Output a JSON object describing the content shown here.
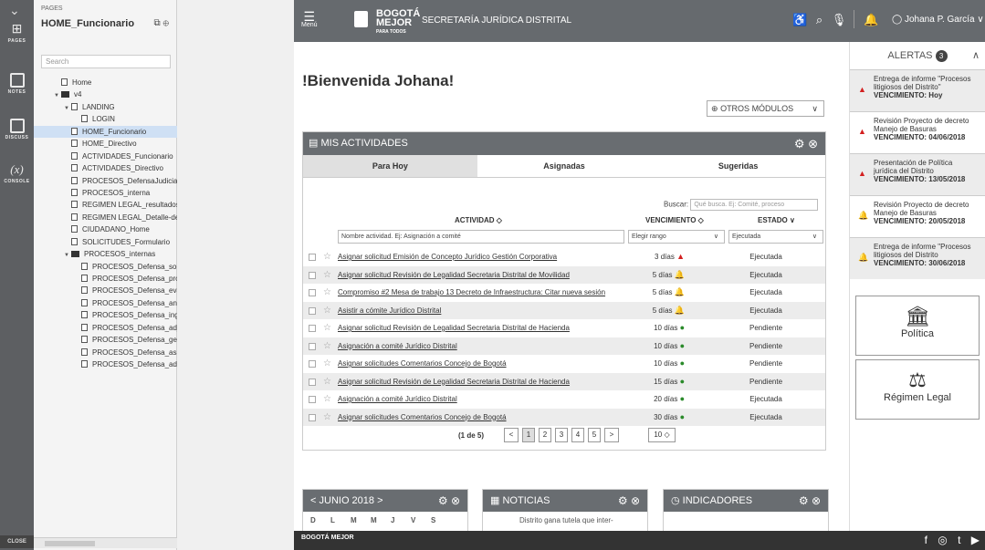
{
  "rail": {
    "items": [
      {
        "label": "PAGES",
        "icon": "sitemap-icon"
      },
      {
        "label": "NOTES",
        "icon": "notes-icon"
      },
      {
        "label": "DISCUSS",
        "icon": "discuss-icon"
      },
      {
        "label": "CONSOLE",
        "icon": "console-icon",
        "glyph": "(x)"
      }
    ],
    "close_label": "CLOSE"
  },
  "pages_panel": {
    "heading": "PAGES",
    "title": "HOME_Funcionario",
    "search_placeholder": "Search",
    "tree": [
      {
        "label": "Home",
        "level": 0,
        "type": "file"
      },
      {
        "label": "v4",
        "level": 0,
        "type": "folder",
        "open": true
      },
      {
        "label": "LANDING",
        "level": 1,
        "type": "file",
        "open": true
      },
      {
        "label": "LOGIN",
        "level": 2,
        "type": "file"
      },
      {
        "label": "HOME_Funcionario",
        "level": 1,
        "type": "file",
        "selected": true
      },
      {
        "label": "HOME_Directivo",
        "level": 1,
        "type": "file"
      },
      {
        "label": "ACTIVIDADES_Funcionario",
        "level": 1,
        "type": "file"
      },
      {
        "label": "ACTIVIDADES_Directivo",
        "level": 1,
        "type": "file"
      },
      {
        "label": "PROCESOS_DefensaJudicial",
        "level": 1,
        "type": "file"
      },
      {
        "label": "PROCESOS_interna",
        "level": 1,
        "type": "file"
      },
      {
        "label": "REGIMEN LEGAL_resultados",
        "level": 1,
        "type": "file"
      },
      {
        "label": "REGIMEN LEGAL_Detalle-decre",
        "level": 1,
        "type": "file"
      },
      {
        "label": "CIUDADANO_Home",
        "level": 1,
        "type": "file"
      },
      {
        "label": "SOLICITUDES_Formulario",
        "level": 1,
        "type": "file"
      },
      {
        "label": "PROCESOS_internas",
        "level": 1,
        "type": "folder",
        "open": true
      },
      {
        "label": "PROCESOS_Defensa_solicit",
        "level": 2,
        "type": "file"
      },
      {
        "label": "PROCESOS_Defensa_proce",
        "level": 2,
        "type": "file"
      },
      {
        "label": "PROCESOS_Defensa_evalu",
        "level": 2,
        "type": "file"
      },
      {
        "label": "PROCESOS_Defensa_anticip",
        "level": 2,
        "type": "file"
      },
      {
        "label": "PROCESOS_Defensa_ingres",
        "level": 2,
        "type": "file"
      },
      {
        "label": "PROCESOS_Defensa_adjunt",
        "level": 2,
        "type": "file"
      },
      {
        "label": "PROCESOS_Defensa_gestio",
        "level": 2,
        "type": "file"
      },
      {
        "label": "PROCESOS_Defensa_asigna",
        "level": 2,
        "type": "file"
      },
      {
        "label": "PROCESOS_Defensa_admin",
        "level": 2,
        "type": "file"
      }
    ]
  },
  "topbar": {
    "menu_label": "Menú",
    "logo_line1": "BOGOTÁ",
    "logo_line2": "MEJOR",
    "logo_line3": "PARA TODOS",
    "section_title": "SECRETARÍA JURÍDICA DISTRITAL",
    "user_name": "Johana P. García"
  },
  "welcome": "!Bienvenida Johana!",
  "otros_modulos": "OTROS MÓDULOS",
  "activities": {
    "title": "MIS ACTIVIDADES",
    "tabs": [
      "Para Hoy",
      "Asignadas",
      "Sugeridas"
    ],
    "search_label": "Buscar:",
    "search_placeholder": "Qué busca. Ej: Comité, proceso",
    "columns": {
      "actividad": "ACTIVIDAD ◇",
      "vencimiento": "VENCIMIENTO ◇",
      "estado": "ESTADO ∨"
    },
    "filters": {
      "actividad_placeholder": "Nombre actividad. Ej: Asignación a comité",
      "rango": "Elegir rango",
      "estado": "Ejecutada"
    },
    "rows": [
      {
        "name": "Asignar solicitud Emisión de Concepto Jurídico Gestión Corporativa",
        "due": "3 días",
        "level": "red",
        "status": "Ejecutada"
      },
      {
        "name": "Asignar solicitud Revisión de Legalidad Secretaria Distrital de Movilidad",
        "due": "5 días",
        "level": "orange",
        "status": "Ejecutada"
      },
      {
        "name": "Compromiso #2 Mesa de trabajo 13 Decreto de Infraestructura: Citar nueva sesión",
        "due": "5 días",
        "level": "orange",
        "status": "Ejecutada"
      },
      {
        "name": "Asistir a cómite Jurídico Distrital",
        "due": "5 días",
        "level": "orange",
        "status": "Ejecutada"
      },
      {
        "name": "Asignar solicitud Revisión de Legalidad Secretaria Distrital de Hacienda",
        "due": "10 días",
        "level": "green",
        "status": "Pendiente"
      },
      {
        "name": "Asignación a comité Jurídico Distrital",
        "due": "10 días",
        "level": "green",
        "status": "Pendiente"
      },
      {
        "name": "Asignar solicitudes Comentarios Concejo de Bogotá",
        "due": "10 días",
        "level": "green",
        "status": "Pendiente"
      },
      {
        "name": "Asignar solicitud Revisión de Legalidad Secretaria Distrital de Hacienda",
        "due": "15 días",
        "level": "green",
        "status": "Pendiente"
      },
      {
        "name": "Asignación a comité Jurídico Distrital",
        "due": "20 días",
        "level": "green",
        "status": "Ejecutada"
      },
      {
        "name": "Asignar solicitudes Comentarios Concejo de Bogotá",
        "due": "30 días",
        "level": "green",
        "status": "Ejecutada"
      }
    ],
    "pager": {
      "info": "(1 de 5)",
      "pages": [
        "1",
        "2",
        "3",
        "4",
        "5"
      ],
      "per_page": "10 ◇"
    }
  },
  "widgets": {
    "calendar": {
      "title": "JUNIO 2018",
      "days": [
        "D",
        "L",
        "M",
        "M",
        "J",
        "V",
        "S"
      ]
    },
    "noticias": {
      "title": "NOTICIAS",
      "snippet": "Distrito gana tutela que inter-"
    },
    "indicadores": {
      "title": "INDICADORES"
    }
  },
  "alerts": {
    "title": "ALERTAS",
    "count": "3",
    "items": [
      {
        "line1": "Entrega de informe \"Procesos",
        "line2": "litigiosos del Distrito\"",
        "due": "VENCIMIENTO: Hoy",
        "level": "red"
      },
      {
        "line1": "Revisión Proyecto de decreto",
        "line2": "Manejo de Basuras",
        "due": "VENCIMIENTO: 04/06/2018",
        "level": "red"
      },
      {
        "line1": "Presentación de Política",
        "line2": "jurídica del Distrito",
        "due": "VENCIMIENTO: 13/05/2018",
        "level": "red"
      },
      {
        "line1": "Revisión Proyecto de decreto",
        "line2": "Manejo de Basuras",
        "due": "VENCIMIENTO: 20/05/2018",
        "level": "orange"
      },
      {
        "line1": "Entrega de informe \"Procesos",
        "line2": "litigiosos del Distrito",
        "due": "VENCIMIENTO: 30/06/2018",
        "level": "orange"
      }
    ],
    "tiles": [
      {
        "label": "Política",
        "icon": "building-icon"
      },
      {
        "label": "Régimen Legal",
        "icon": "gavel-icon"
      }
    ]
  },
  "footer": {
    "logo": "BOGOTÁ MEJOR"
  },
  "colors": {
    "bar": "#666a6e",
    "panel_head": "#696d71",
    "selected": "#cfe0f4",
    "alert_red": "#d32020",
    "alert_orange": "#f0a020",
    "ok_green": "#2a8a2a"
  }
}
